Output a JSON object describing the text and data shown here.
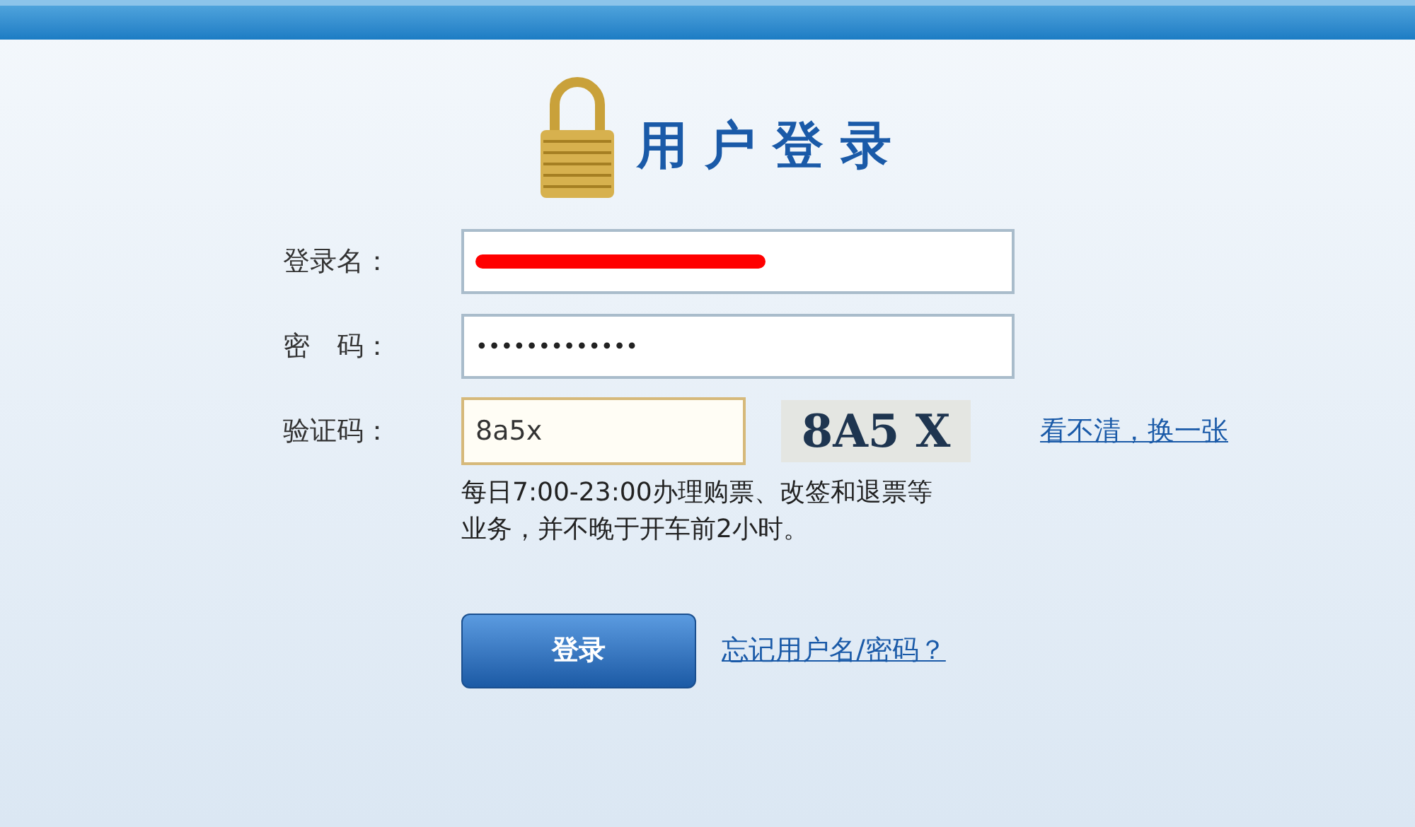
{
  "header": {
    "title": "用户登录"
  },
  "form": {
    "fields": [
      {
        "kind": "text",
        "label": "登录名：",
        "redacted": true
      },
      {
        "kind": "password",
        "label": "密　码：",
        "value": "•••••••••••••"
      },
      {
        "kind": "captcha",
        "label": "验证码：",
        "value": "8a5x",
        "focused": true,
        "captcha_text": "8A5 X",
        "refresh_link": "看不清，换一张"
      }
    ],
    "notice": "每日7:00-23:00办理购票、改签和退票等业务，并不晚于开车前2小时。",
    "submit": "登录",
    "forgot_link": "忘记用户名/密码？"
  }
}
